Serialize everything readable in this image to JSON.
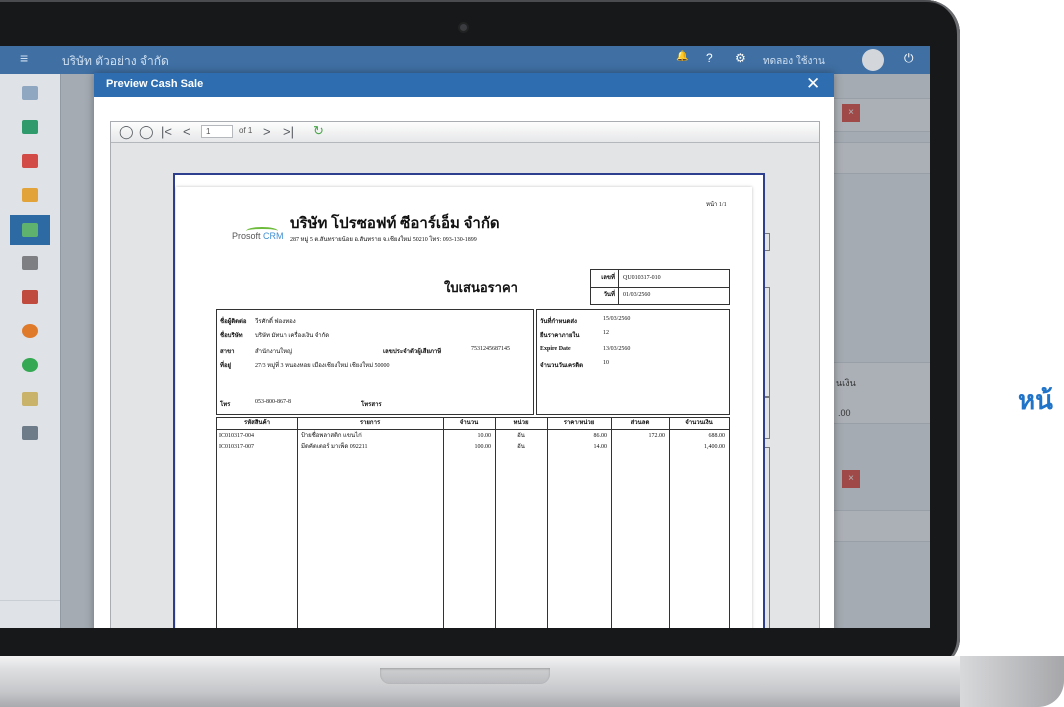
{
  "app": {
    "company_name": "บริษัท ตัวอย่าง จำกัด",
    "user_name": "ทดลอง ใช้งาน",
    "menu_icon": "≡",
    "bell_icon": "🔔",
    "help_icon": "?",
    "settings_icon": "⚙",
    "power_icon": "⏻"
  },
  "background": {
    "right_header_partial": "นเงิน",
    "right_value_partial": ".00",
    "red_close": "×"
  },
  "modal": {
    "title": "Preview Cash Sale",
    "close_label": "✕"
  },
  "viewer": {
    "first_btn": "◯",
    "prev_circle_btn": "◯",
    "first_page_btn": "|<",
    "prev_page_btn": "<",
    "page_value": "1",
    "of_label": "of 1",
    "next_page_btn": ">",
    "last_page_btn": ">|",
    "refresh_icon": "↻"
  },
  "document": {
    "page_label": "หน้า 1/1",
    "company": "บริษัท โปรซอฟท์ ซีอาร์เอ็ม จำกัด",
    "logo_text": "Prosoft",
    "logo_crm": "CRM",
    "address": "287 หมู่ 5 ต.สันทรายน้อย อ.สันทราย จ.เชียงใหม่ 50210 โทร: 093-130-1899",
    "title": "ใบเสนอราคา",
    "number_label": "เลขที่",
    "number_value": "QU010317-010",
    "date_label": "วันที่",
    "date_value": "01/03/2560",
    "contact_label": "ชื่อผู้ติดต่อ",
    "contact_value": "วีรศักดิ์ ฟ่องทอง",
    "company_label": "ชื่อบริษัท",
    "company_value": "บริษัท มัทนา เครื่องเงิน จำกัด",
    "branch_label": "สาขา",
    "branch_value": "สำนักงานใหญ่",
    "tax_label": "เลขประจำตัวผู้เสียภาษี",
    "tax_value": "7531245687145",
    "addr_label": "ที่อยู่",
    "addr_value": "27/3 หมู่ที่ 3 หนองหอย เมืองเชียงใหม่ เชียงใหม่ 50000",
    "phone_label": "โทร",
    "phone_value": "053-800-867-8",
    "fax_label": "โทรสาร",
    "due_label": "วันที่กำหนดส่ง",
    "due_value": "15/03/2560",
    "pay_label": "ยืนราคาภายใน",
    "pay_value": "12",
    "expire_label": "Expire Date",
    "expire_value": "13/03/2560",
    "credit_label": "จำนวนวันเครดิต",
    "credit_value": "10",
    "table": {
      "headers": [
        "รหัสสินค้า",
        "รายการ",
        "จำนวน",
        "หน่วย",
        "ราคา/หน่วย",
        "ส่วนลด",
        "จำนวนเงิน"
      ],
      "rows": [
        [
          "IC010317-004",
          "ป้ายชื่อพลาสติก แขนไก่",
          "10.00",
          "อัน",
          "86.00",
          "172.00",
          "688.00"
        ],
        [
          "IC010317-007",
          "มีดคัตเตอร์ มาเพ็ด 092211",
          "100.00",
          "อัน",
          "14.00",
          "",
          "1,400.00"
        ]
      ]
    }
  },
  "side_heading": "หน้"
}
